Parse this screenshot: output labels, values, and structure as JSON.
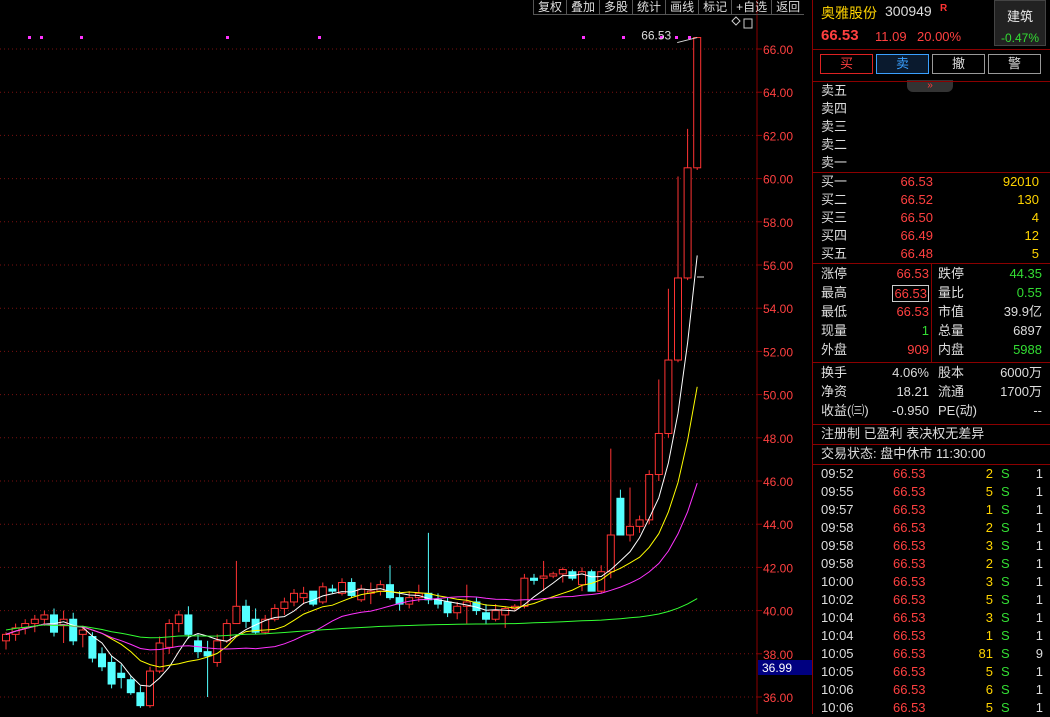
{
  "toolbar": [
    "复权",
    "叠加",
    "多股",
    "统计",
    "画线",
    "标记",
    "+自选",
    "返回"
  ],
  "chart": {
    "y_labels": [
      "66.00",
      "64.00",
      "62.00",
      "60.00",
      "58.00",
      "56.00",
      "54.00",
      "52.00",
      "50.00",
      "48.00",
      "46.00",
      "44.00",
      "42.00",
      "40.00",
      "38.00",
      "36.00"
    ],
    "price_tag": "66.53",
    "current_box": "36.99",
    "colors": {
      "up": "#ff3333",
      "down": "#54ffff",
      "ma5": "#ffffff",
      "ma10": "#ffff00",
      "ma20": "#ff33ff",
      "ma60": "#33ff33"
    }
  },
  "chart_data": {
    "type": "candlestick",
    "ylim": [
      35.5,
      67.0
    ],
    "candles": [
      [
        38.6,
        39.0,
        38.2,
        38.9
      ],
      [
        38.9,
        39.4,
        38.6,
        39.2
      ],
      [
        39.2,
        39.6,
        38.9,
        39.4
      ],
      [
        39.4,
        39.8,
        39.0,
        39.6
      ],
      [
        39.6,
        40.0,
        39.3,
        39.8
      ],
      [
        39.8,
        40.1,
        38.8,
        39.0
      ],
      [
        39.3,
        40.0,
        38.5,
        39.6
      ],
      [
        39.6,
        39.9,
        38.4,
        38.6
      ],
      [
        38.9,
        39.3,
        38.3,
        39.1
      ],
      [
        38.8,
        39.0,
        37.6,
        37.8
      ],
      [
        38.0,
        38.3,
        37.2,
        37.4
      ],
      [
        37.6,
        37.9,
        36.4,
        36.6
      ],
      [
        37.1,
        37.5,
        36.4,
        36.9
      ],
      [
        36.8,
        37.0,
        36.1,
        36.2
      ],
      [
        36.2,
        36.5,
        35.5,
        35.6
      ],
      [
        35.6,
        37.4,
        35.5,
        37.2
      ],
      [
        37.2,
        38.8,
        37.1,
        38.5
      ],
      [
        38.3,
        39.6,
        38.0,
        39.4
      ],
      [
        39.4,
        40.0,
        39.0,
        39.8
      ],
      [
        39.8,
        40.2,
        38.7,
        38.9
      ],
      [
        38.6,
        38.9,
        37.8,
        38.1
      ],
      [
        38.1,
        38.6,
        36.0,
        37.9
      ],
      [
        37.6,
        38.9,
        37.4,
        38.6
      ],
      [
        38.6,
        39.6,
        38.5,
        39.4
      ],
      [
        39.4,
        42.3,
        39.4,
        40.2
      ],
      [
        40.2,
        40.5,
        39.2,
        39.5
      ],
      [
        39.6,
        40.1,
        38.9,
        39.0
      ],
      [
        39.0,
        39.8,
        38.9,
        39.6
      ],
      [
        39.6,
        40.3,
        39.5,
        40.1
      ],
      [
        40.1,
        40.6,
        39.8,
        40.4
      ],
      [
        40.4,
        41.0,
        40.2,
        40.8
      ],
      [
        40.6,
        41.1,
        40.3,
        40.8
      ],
      [
        40.9,
        40.9,
        40.2,
        40.3
      ],
      [
        40.4,
        41.3,
        40.3,
        41.1
      ],
      [
        41.0,
        41.2,
        40.8,
        40.9
      ],
      [
        40.8,
        41.5,
        40.7,
        41.3
      ],
      [
        41.3,
        41.5,
        40.6,
        40.7
      ],
      [
        40.5,
        41.2,
        40.4,
        41.0
      ],
      [
        40.8,
        41.3,
        40.3,
        40.9
      ],
      [
        40.9,
        41.4,
        40.7,
        41.2
      ],
      [
        41.2,
        42.1,
        40.5,
        40.6
      ],
      [
        40.6,
        40.9,
        40.0,
        40.3
      ],
      [
        40.3,
        40.9,
        40.1,
        40.6
      ],
      [
        40.6,
        41.2,
        40.4,
        40.8
      ],
      [
        40.8,
        43.6,
        40.3,
        40.5
      ],
      [
        40.5,
        40.8,
        40.1,
        40.3
      ],
      [
        40.4,
        40.6,
        39.7,
        39.9
      ],
      [
        39.9,
        40.4,
        39.6,
        40.2
      ],
      [
        40.2,
        41.2,
        39.4,
        40.4
      ],
      [
        40.4,
        40.6,
        39.8,
        40.0
      ],
      [
        39.9,
        40.3,
        39.4,
        39.6
      ],
      [
        39.6,
        40.3,
        39.5,
        40.0
      ],
      [
        39.8,
        40.2,
        39.2,
        40.1
      ],
      [
        40.1,
        40.3,
        40.0,
        40.2
      ],
      [
        40.2,
        41.7,
        40.1,
        41.5
      ],
      [
        41.5,
        41.7,
        41.2,
        41.4
      ],
      [
        41.5,
        42.3,
        40.9,
        41.6
      ],
      [
        41.6,
        41.8,
        41.5,
        41.7
      ],
      [
        41.7,
        42.0,
        41.3,
        41.9
      ],
      [
        41.8,
        41.9,
        41.4,
        41.5
      ],
      [
        41.2,
        42.0,
        40.9,
        41.8
      ],
      [
        41.8,
        41.9,
        40.9,
        40.9
      ],
      [
        40.9,
        42.1,
        40.8,
        41.8
      ],
      [
        41.8,
        47.5,
        41.5,
        43.5
      ],
      [
        45.2,
        45.6,
        43.5,
        43.5
      ],
      [
        43.5,
        45.7,
        43.2,
        43.9
      ],
      [
        43.9,
        44.4,
        43.6,
        44.2
      ],
      [
        44.2,
        46.5,
        44.0,
        46.3
      ],
      [
        46.3,
        50.7,
        46.0,
        48.2
      ],
      [
        48.2,
        54.9,
        48.0,
        51.6
      ],
      [
        51.6,
        60.1,
        51.5,
        55.4
      ],
      [
        55.4,
        62.3,
        55.3,
        60.5
      ],
      [
        60.5,
        66.53,
        60.4,
        66.53
      ]
    ],
    "ma_days": [
      5,
      10,
      20,
      60
    ],
    "last_price": 66.53
  },
  "panel": {
    "name": "奥雅股份",
    "code": "300949",
    "flag": "R",
    "price": "66.53",
    "change": "11.09",
    "pct": "20.00%",
    "sector_name": "建筑",
    "sector_pct": "-0.47%",
    "buttons": {
      "buy": "买",
      "sell": "卖",
      "cancel": "撤",
      "alert": "警"
    },
    "collapse": "»",
    "sells": [
      "卖五",
      "卖四",
      "卖三",
      "卖二",
      "卖一"
    ],
    "buys": [
      {
        "label": "买一",
        "price": "66.53",
        "vol": "92010"
      },
      {
        "label": "买二",
        "price": "66.52",
        "vol": "130"
      },
      {
        "label": "买三",
        "price": "66.50",
        "vol": "4"
      },
      {
        "label": "买四",
        "price": "66.49",
        "vol": "12"
      },
      {
        "label": "买五",
        "price": "66.48",
        "vol": "5"
      }
    ],
    "stats1": [
      {
        "l": "涨停",
        "v": "66.53",
        "c": "red",
        "l2": "跌停",
        "v2": "44.35",
        "c2": "grn"
      },
      {
        "l": "最高",
        "v": "66.53",
        "c": "red",
        "boxed": true,
        "l2": "量比",
        "v2": "0.55",
        "c2": "grn"
      },
      {
        "l": "最低",
        "v": "66.53",
        "c": "red",
        "l2": "市值",
        "v2": "39.9亿",
        "c2": "wht"
      },
      {
        "l": "现量",
        "v": "1",
        "c": "grn",
        "l2": "总量",
        "v2": "6897",
        "c2": "wht"
      },
      {
        "l": "外盘",
        "v": "909",
        "c": "red",
        "l2": "内盘",
        "v2": "5988",
        "c2": "grn"
      }
    ],
    "stats2": [
      {
        "l": "换手",
        "v": "4.06%",
        "l2": "股本",
        "v2": "6000万"
      },
      {
        "l": "净资",
        "v": "18.21",
        "l2": "流通",
        "v2": "1700万"
      },
      {
        "l": "收益(㈢)",
        "v": "-0.950",
        "l2": "PE(动)",
        "v2": "--"
      }
    ],
    "tags": "注册制 已盈利 表决权无差异",
    "status": "交易状态: 盘中休市 11:30:00",
    "ticks": [
      {
        "t": "09:52",
        "p": "66.53",
        "v": "2",
        "s": "S",
        "n": "1"
      },
      {
        "t": "09:55",
        "p": "66.53",
        "v": "5",
        "s": "S",
        "n": "1"
      },
      {
        "t": "09:57",
        "p": "66.53",
        "v": "1",
        "s": "S",
        "n": "1"
      },
      {
        "t": "09:58",
        "p": "66.53",
        "v": "2",
        "s": "S",
        "n": "1"
      },
      {
        "t": "09:58",
        "p": "66.53",
        "v": "3",
        "s": "S",
        "n": "1"
      },
      {
        "t": "09:58",
        "p": "66.53",
        "v": "2",
        "s": "S",
        "n": "1"
      },
      {
        "t": "10:00",
        "p": "66.53",
        "v": "3",
        "s": "S",
        "n": "1"
      },
      {
        "t": "10:02",
        "p": "66.53",
        "v": "5",
        "s": "S",
        "n": "1"
      },
      {
        "t": "10:04",
        "p": "66.53",
        "v": "3",
        "s": "S",
        "n": "1"
      },
      {
        "t": "10:04",
        "p": "66.53",
        "v": "1",
        "s": "S",
        "n": "1"
      },
      {
        "t": "10:05",
        "p": "66.53",
        "v": "81",
        "s": "S",
        "n": "9"
      },
      {
        "t": "10:05",
        "p": "66.53",
        "v": "5",
        "s": "S",
        "n": "1"
      },
      {
        "t": "10:06",
        "p": "66.53",
        "v": "6",
        "s": "S",
        "n": "1"
      },
      {
        "t": "10:06",
        "p": "66.53",
        "v": "5",
        "s": "S",
        "n": "1"
      }
    ]
  }
}
